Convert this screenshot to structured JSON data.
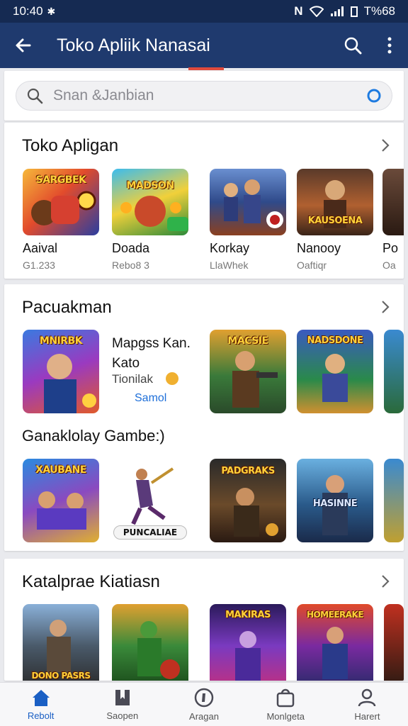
{
  "status_bar": {
    "time": "10:40",
    "battery_text": "T%68"
  },
  "app_bar": {
    "title": "Toko Apliik Nanasai"
  },
  "search": {
    "placeholder": "Snan &Janbian"
  },
  "sections": [
    {
      "title": "Toko Apligan",
      "apps": [
        {
          "name": "Aaival",
          "sub": "G1.233",
          "art": "SARGBEK"
        },
        {
          "name": "Doada",
          "sub": "Rebo8 3",
          "art": "MADSON"
        },
        {
          "name": "Korkay",
          "sub": "LlaWhek",
          "art": ""
        },
        {
          "name": "Nanooy",
          "sub": "Oaftiqr",
          "art": "KAUSOENA"
        },
        {
          "name": "Po",
          "sub": "Oa",
          "art": ""
        }
      ]
    },
    {
      "title": "Pacuakman",
      "featured": {
        "title": "Mapgss Kan. Kato",
        "subtitle": "Tionilak",
        "link": "Samol",
        "art": "MNIRBK"
      },
      "apps_row1": [
        {
          "art": "MACSIE"
        },
        {
          "art": "NADSDONE"
        }
      ],
      "subtitle": "Ganaklolay Gambe:)",
      "apps_row2": [
        {
          "art": "XAUBANE"
        },
        {
          "art": "PUNCALIAE"
        },
        {
          "art": "PADGRAKS"
        },
        {
          "art": "HASINNE"
        }
      ]
    },
    {
      "title": "Katalprae Kiatiasn",
      "apps": [
        {
          "art": "DONO PASRS"
        },
        {
          "art": ""
        },
        {
          "art": "MAKIRAS"
        },
        {
          "art": "HOMEERAKE"
        }
      ]
    }
  ],
  "bottom_nav": [
    {
      "label": "Rebolt",
      "icon": "home-icon"
    },
    {
      "label": "Saopen",
      "icon": "bookmark-icon"
    },
    {
      "label": "Aragan",
      "icon": "compass-icon"
    },
    {
      "label": "Monlgeta",
      "icon": "bag-icon"
    },
    {
      "label": "Harert",
      "icon": "person-icon"
    }
  ],
  "colors": {
    "status_bar": "#152a52",
    "app_bar": "#1f3a6e",
    "accent": "#1a5fc4",
    "indicator": "#e04a3c"
  }
}
